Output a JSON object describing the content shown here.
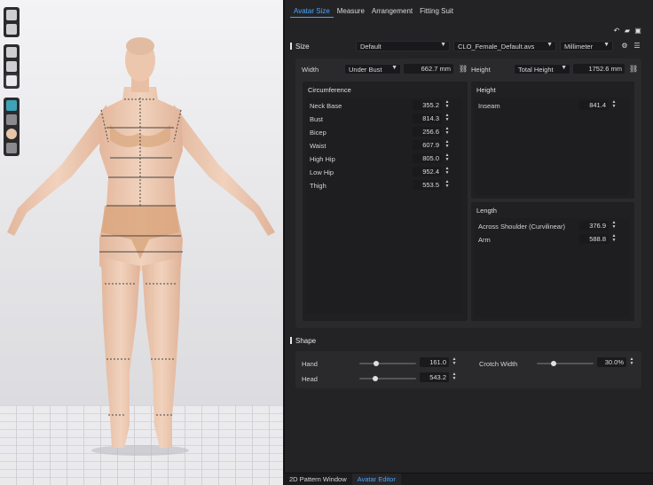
{
  "colors": {
    "accent": "#4ba3ff",
    "panel": "#232326",
    "skin": "#ecc7ad"
  },
  "tabs": [
    "Avatar Size",
    "Measure",
    "Arrangement",
    "Fitting Suit"
  ],
  "top_icons": [
    "undo-icon",
    "open-folder-icon",
    "save-icon"
  ],
  "size": {
    "title": "Size",
    "preset": "Default",
    "file": "CLO_Female_Default.avs",
    "unit": "Millimeter",
    "width_label": "Width",
    "width_mode": "Under Bust",
    "width_value": "662.7 mm",
    "height_label": "Height",
    "height_mode": "Total Height",
    "height_value": "1752.6 mm"
  },
  "circumference": {
    "title": "Circumference",
    "rows": [
      {
        "label": "Neck Base",
        "value": "355.2"
      },
      {
        "label": "Bust",
        "value": "814.3"
      },
      {
        "label": "Bicep",
        "value": "256.6"
      },
      {
        "label": "Waist",
        "value": "607.9"
      },
      {
        "label": "High Hip",
        "value": "805.0"
      },
      {
        "label": "Low Hip",
        "value": "952.4"
      },
      {
        "label": "Thigh",
        "value": "553.5"
      }
    ]
  },
  "height_box": {
    "title": "Height",
    "rows": [
      {
        "label": "Inseam",
        "value": "841.4"
      }
    ]
  },
  "length_box": {
    "title": "Length",
    "rows": [
      {
        "label": "Across Shoulder (Curvilinear)",
        "value": "376.9"
      },
      {
        "label": "Arm",
        "value": "588.8"
      }
    ]
  },
  "shape": {
    "title": "Shape",
    "hand_label": "Hand",
    "hand_value": "161.0",
    "hand_level": 0.3,
    "head_label": "Head",
    "head_value": "543.2",
    "head_level": 0.28,
    "crotch_label": "Crotch Width",
    "crotch_value": "30.0%",
    "crotch_level": 0.3
  },
  "bottom_tabs": [
    "2D Pattern Window",
    "Avatar Editor"
  ]
}
